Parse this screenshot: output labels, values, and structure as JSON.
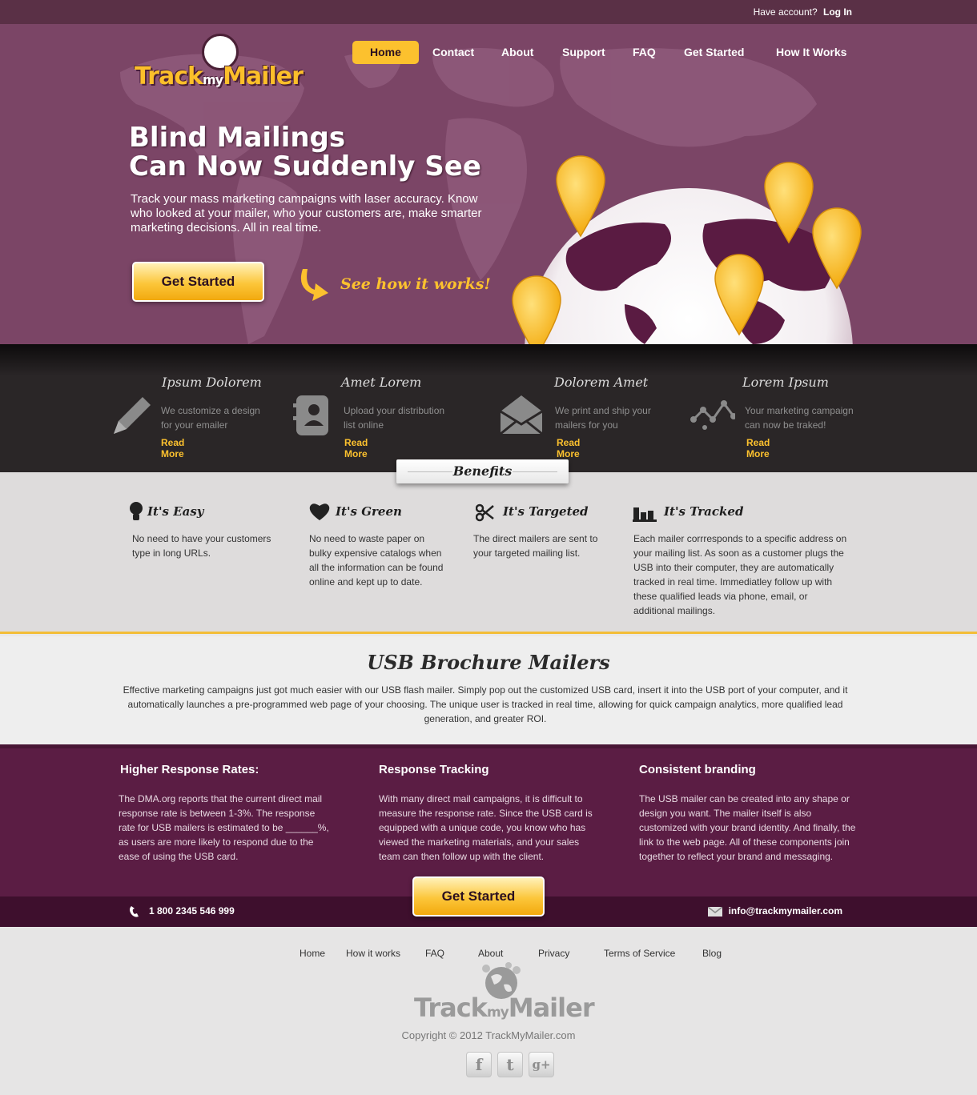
{
  "topbar": {
    "prompt": "Have account?",
    "login": "Log In"
  },
  "logo": {
    "track": "Track",
    "my": "my",
    "mailer": "Mailer"
  },
  "nav": [
    "Home",
    "Contact",
    "About",
    "Support",
    "FAQ",
    "Get Started",
    "How It Works"
  ],
  "hero": {
    "title_line1": "Blind Mailings",
    "title_line2": "Can Now Suddenly See",
    "lead": "Track your mass marketing campaigns with laser accuracy. Know who looked at your mailer, who your customers are, make smarter marketing decisions. All in real time.",
    "cta": "Get Started",
    "see_how": "See how it works!"
  },
  "features": [
    {
      "title": "Ipsum Dolorem",
      "desc": "We customize a design for your emailer",
      "more": "Read More",
      "icon": "pencil-icon"
    },
    {
      "title": "Amet Lorem",
      "desc": "Upload your distribution list online",
      "more": "Read More",
      "icon": "contacts-book-icon"
    },
    {
      "title": "Dolorem Amet",
      "desc": "We print and ship your mailers for you",
      "more": "Read More",
      "icon": "envelope-icon"
    },
    {
      "title": "Lorem Ipsum",
      "desc": "Your marketing campaign can now be traked!",
      "more": "Read More",
      "icon": "tracking-graph-icon"
    }
  ],
  "benefits": {
    "tab": "Benefits",
    "items": [
      {
        "title": "It's Easy",
        "desc": "No need to have your customers type in long URLs.",
        "icon": "lightbulb-icon"
      },
      {
        "title": "It's Green",
        "desc": "No need to waste paper on bulky expensive catalogs when all the information can be found online and kept up to date.",
        "icon": "heart-icon"
      },
      {
        "title": "It's Targeted",
        "desc": "The direct mailers are sent to your targeted mailing list.",
        "icon": "scissors-icon"
      },
      {
        "title": "It's Tracked",
        "desc": "Each mailer corrresponds to a specific address on your mailing list. As soon as a customer plugs the USB into their computer, they are automatically tracked in real time. Immediatley follow up with these qualified leads via phone, email, or additional mailings.",
        "icon": "bar-chart-icon"
      }
    ]
  },
  "usb": {
    "title": "USB Brochure Mailers",
    "text": "Effective marketing campaigns just got much easier with our USB flash mailer. Simply pop out the customized USB card, insert it into the USB port of your computer, and it automatically launches a pre-programmed web page of your choosing. The unique user is tracked in real time, allowing for quick campaign analytics, more qualified lead generation, and greater ROI."
  },
  "info": [
    {
      "title": "Higher Response Rates:",
      "text": "The DMA.org reports that the current direct mail response rate is between 1-3%. The response rate for USB mailers is estimated to be ______%, as users are more likely to respond due to the ease of using the USB card."
    },
    {
      "title": "Response Tracking",
      "text": "With many direct mail campaigns, it is difficult to measure the response rate. Since the USB card is equipped with a unique code, you know who has viewed the marketing materials, and your sales team can then follow up with the client."
    },
    {
      "title": "Consistent branding",
      "text": "The USB mailer can be created into any shape or design you want. The mailer itself is also customized with your brand identity. And finally, the link to the web page. All of these components join together to reflect your brand and messaging."
    }
  ],
  "cta2": "Get Started",
  "contact": {
    "phone": "1 800 2345 546 999",
    "email": "info@trackmymailer.com"
  },
  "footer": {
    "links": [
      "Home",
      "How it works",
      "FAQ",
      "About",
      "Privacy",
      "Terms of Service",
      "Blog"
    ],
    "copyright": "Copyright © 2012 TrackMyMailer.com",
    "social": [
      "f",
      "t",
      "g+"
    ]
  },
  "colors": {
    "brand_purple": "#7b4566",
    "deep_purple": "#5b1d44",
    "accent_yellow": "#fcc12e"
  }
}
